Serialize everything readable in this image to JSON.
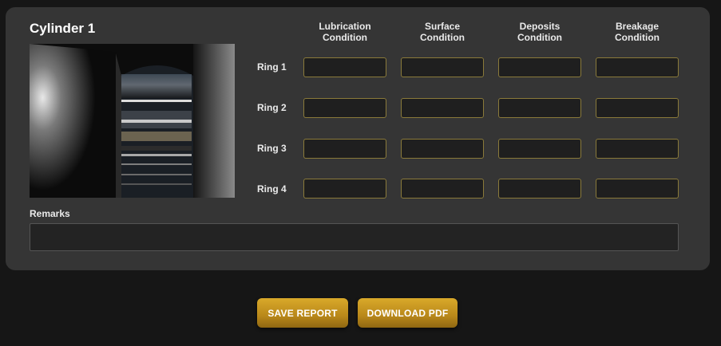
{
  "cylinder": {
    "title": "Cylinder 1",
    "photo_alt": "cylinder-bore-photo"
  },
  "columns": [
    {
      "line1": "Lubrication",
      "line2": "Condition"
    },
    {
      "line1": "Surface",
      "line2": "Condition"
    },
    {
      "line1": "Deposits",
      "line2": "Condition"
    },
    {
      "line1": "Breakage",
      "line2": "Condition"
    }
  ],
  "rings": [
    "Ring 1",
    "Ring 2",
    "Ring 3",
    "Ring 4"
  ],
  "cells": [
    [
      "",
      "",
      "",
      ""
    ],
    [
      "",
      "",
      "",
      ""
    ],
    [
      "",
      "",
      "",
      ""
    ],
    [
      "",
      "",
      "",
      ""
    ]
  ],
  "remarks": {
    "label": "Remarks",
    "value": ""
  },
  "actions": {
    "save_label": "SAVE REPORT",
    "download_label": "DOWNLOAD PDF"
  },
  "colors": {
    "accent": "#c99a22",
    "card": "#353535",
    "background": "#161616",
    "field_border": "#8a7a3a"
  }
}
